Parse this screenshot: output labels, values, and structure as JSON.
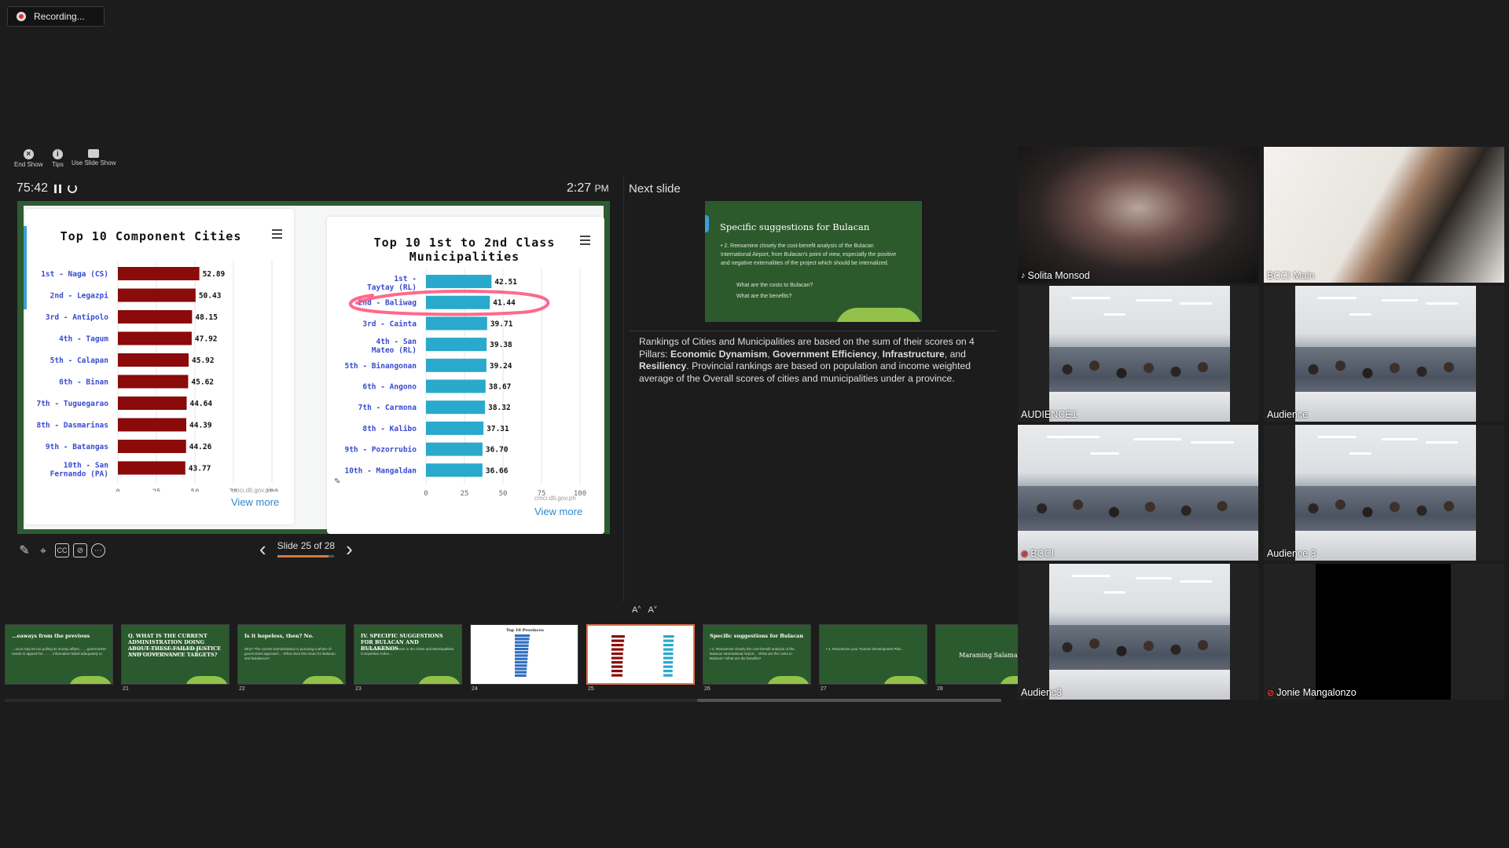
{
  "recording": {
    "label": "Recording..."
  },
  "toolbar": {
    "end_show": "End Show",
    "tips": "Tips",
    "use_slide_show": "Use Slide Show"
  },
  "presenter": {
    "elapsed": "75:42",
    "clock_time": "2:27",
    "clock_period": "PM",
    "next_slide_label": "Next slide",
    "slide_counter": "Slide 25 of 28",
    "progress": 0.893,
    "notes_intro": "Rankings of Cities and Municipalities are based on the sum of their scores on 4 Pillars: ",
    "notes_p1": "Economic Dynamism",
    "notes_sep1": ", ",
    "notes_p2": "Government Efficiency",
    "notes_sep2": ", ",
    "notes_p3": "Infrastructure",
    "notes_sep3": ", and ",
    "notes_p4": "Resiliency",
    "notes_rest": ". Provincial rankings are based on population and income weighted average of the Overall scores of cities and municipalities under a province."
  },
  "controls": {
    "cc": "CC"
  },
  "current_slide": {
    "left_card": {
      "source": "cmci.dti.gov.ph",
      "view_more": "View more"
    },
    "right_card": {
      "source": "cmci.dti.gov.ph",
      "view_more": "View more"
    }
  },
  "chart_data": [
    {
      "type": "bar",
      "orientation": "horizontal",
      "title": "Top 10 Component Cities",
      "categories": [
        "1st - Naga (CS)",
        "2nd - Legazpi",
        "3rd - Antipolo",
        "4th - Tagum",
        "5th - Calapan",
        "6th - Binan",
        "7th - Tuguegarao",
        "8th - Dasmarinas",
        "9th - Batangas",
        "10th - San Fernando (PA)"
      ],
      "values": [
        52.89,
        50.43,
        48.15,
        47.92,
        45.92,
        45.62,
        44.64,
        44.39,
        44.26,
        43.77
      ],
      "xticks": [
        "0",
        "25",
        "50",
        "75",
        "100"
      ],
      "xlim": [
        0,
        100
      ],
      "color": "#8b0a0a"
    },
    {
      "type": "bar",
      "orientation": "horizontal",
      "title": "Top 10 1st to 2nd Class Municipalities",
      "categories": [
        "1st - Taytay (RL)",
        "2nd - Baliwag",
        "3rd - Cainta",
        "4th - San Mateo (RL)",
        "5th - Binangonan",
        "6th - Angono",
        "7th - Carmona",
        "8th - Kalibo",
        "9th - Pozorrubio",
        "10th - Mangaldan"
      ],
      "values": [
        42.51,
        41.44,
        39.71,
        39.38,
        39.24,
        38.67,
        38.32,
        37.31,
        36.7,
        36.66
      ],
      "xticks": [
        "0",
        "25",
        "50",
        "75",
        "100"
      ],
      "xlim": [
        0,
        100
      ],
      "color": "#29a9cc",
      "annotation": "red hand-drawn circle around 2nd - Baliwag"
    }
  ],
  "next_slide": {
    "title": "Specific suggestions for Bulacan",
    "body": "• 2.  Reexamine closely the cost-benefit analysis of the Bulacan International Airport, from Bulacan's point of view, especially the positive and negative externalities of the project which should be internalized.",
    "q1": "What are the costs to Bulacan?",
    "q2": "What are the benefits?"
  },
  "thumbnails": [
    {
      "num": "",
      "title": "…eaways from the previous",
      "body": "…ocus may be too polling its money affairs… …government needs to appeal the … … information failed adequately to",
      "white": false
    },
    {
      "num": "21",
      "title": "Q. WHAT IS THE CURRENT ADMINISTRATION DOING ABOUT THESE FAILED JUSTICE AND GOVERNANCE TARGETS?",
      "body": "• A. THEY HAVE REMOVED THE INDICATORS AS TARGETS IN THE PDP 2023-2028",
      "white": false
    },
    {
      "num": "22",
      "title": "Is it hopeless, then? No.",
      "body": "Why? The current administration is pursuing a whole-of-government approach…   What does this mean for Bulacan and Bulakenos?",
      "white": false
    },
    {
      "num": "23",
      "title": "IV. SPECIFIC SUGGESTIONS FOR BULACAN AND BULAKENOS",
      "body": "• 1. Improve Bulacan's Rank in the Cities and Municipalities Competitive Index…",
      "white": false
    },
    {
      "num": "24",
      "title": "Top 10 Provinces",
      "body": "",
      "white": true
    },
    {
      "num": "25",
      "title": "",
      "body": "",
      "white": true
    },
    {
      "num": "26",
      "title": "Specific suggestions for Bulacan",
      "body": "• 2. Reexamine closely the cost-benefit analysis of the Bulacan International Airport… What are the costs to Bulacan? What are the benefits?",
      "white": false
    },
    {
      "num": "27",
      "title": "",
      "body": "• 3. Reexamine your Tourism Development Plan…",
      "white": false
    },
    {
      "num": "28",
      "title": "",
      "center": "Maraming Salamat",
      "white": false
    }
  ],
  "participants": [
    {
      "name": "Solita Monsod",
      "muted": false,
      "active": true
    },
    {
      "name": "BCCI Main",
      "muted": false,
      "active": false
    },
    {
      "name": "AUDIENCE1",
      "muted": false,
      "active": false
    },
    {
      "name": "Audience",
      "muted": false,
      "active": false
    },
    {
      "name": "BCCI",
      "muted": true,
      "active": false
    },
    {
      "name": "Audience 3",
      "muted": false,
      "active": false
    },
    {
      "name": "Audienc3",
      "muted": false,
      "active": false
    },
    {
      "name": "Jonie Mangalonzo",
      "muted": true,
      "active": false
    }
  ],
  "colors": {
    "accent": "#d57b3c",
    "active_speaker": "#dfe04a",
    "muted": "#e0322f"
  }
}
